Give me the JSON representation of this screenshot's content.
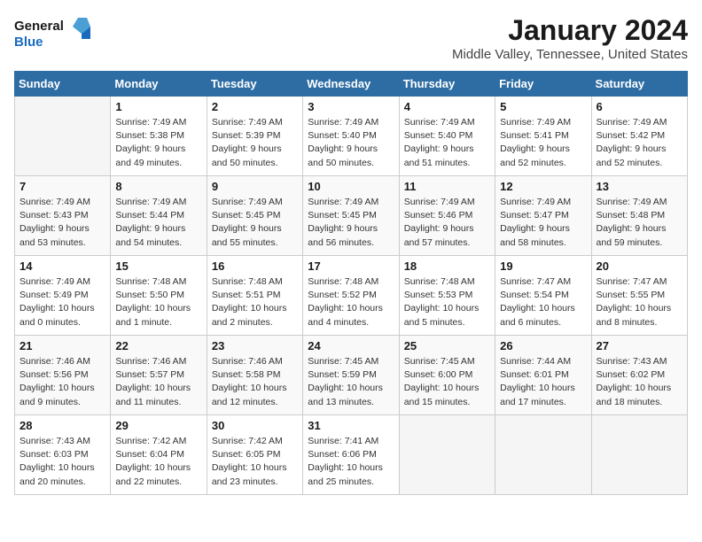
{
  "header": {
    "logo_line1": "General",
    "logo_line2": "Blue",
    "month": "January 2024",
    "location": "Middle Valley, Tennessee, United States"
  },
  "weekdays": [
    "Sunday",
    "Monday",
    "Tuesday",
    "Wednesday",
    "Thursday",
    "Friday",
    "Saturday"
  ],
  "weeks": [
    [
      {
        "day": "",
        "empty": true
      },
      {
        "day": "1",
        "sunrise": "7:49 AM",
        "sunset": "5:38 PM",
        "daylight": "9 hours and 49 minutes."
      },
      {
        "day": "2",
        "sunrise": "7:49 AM",
        "sunset": "5:39 PM",
        "daylight": "9 hours and 50 minutes."
      },
      {
        "day": "3",
        "sunrise": "7:49 AM",
        "sunset": "5:40 PM",
        "daylight": "9 hours and 50 minutes."
      },
      {
        "day": "4",
        "sunrise": "7:49 AM",
        "sunset": "5:40 PM",
        "daylight": "9 hours and 51 minutes."
      },
      {
        "day": "5",
        "sunrise": "7:49 AM",
        "sunset": "5:41 PM",
        "daylight": "9 hours and 52 minutes."
      },
      {
        "day": "6",
        "sunrise": "7:49 AM",
        "sunset": "5:42 PM",
        "daylight": "9 hours and 52 minutes."
      }
    ],
    [
      {
        "day": "7",
        "sunrise": "7:49 AM",
        "sunset": "5:43 PM",
        "daylight": "9 hours and 53 minutes."
      },
      {
        "day": "8",
        "sunrise": "7:49 AM",
        "sunset": "5:44 PM",
        "daylight": "9 hours and 54 minutes."
      },
      {
        "day": "9",
        "sunrise": "7:49 AM",
        "sunset": "5:45 PM",
        "daylight": "9 hours and 55 minutes."
      },
      {
        "day": "10",
        "sunrise": "7:49 AM",
        "sunset": "5:45 PM",
        "daylight": "9 hours and 56 minutes."
      },
      {
        "day": "11",
        "sunrise": "7:49 AM",
        "sunset": "5:46 PM",
        "daylight": "9 hours and 57 minutes."
      },
      {
        "day": "12",
        "sunrise": "7:49 AM",
        "sunset": "5:47 PM",
        "daylight": "9 hours and 58 minutes."
      },
      {
        "day": "13",
        "sunrise": "7:49 AM",
        "sunset": "5:48 PM",
        "daylight": "9 hours and 59 minutes."
      }
    ],
    [
      {
        "day": "14",
        "sunrise": "7:49 AM",
        "sunset": "5:49 PM",
        "daylight": "10 hours and 0 minutes."
      },
      {
        "day": "15",
        "sunrise": "7:48 AM",
        "sunset": "5:50 PM",
        "daylight": "10 hours and 1 minute."
      },
      {
        "day": "16",
        "sunrise": "7:48 AM",
        "sunset": "5:51 PM",
        "daylight": "10 hours and 2 minutes."
      },
      {
        "day": "17",
        "sunrise": "7:48 AM",
        "sunset": "5:52 PM",
        "daylight": "10 hours and 4 minutes."
      },
      {
        "day": "18",
        "sunrise": "7:48 AM",
        "sunset": "5:53 PM",
        "daylight": "10 hours and 5 minutes."
      },
      {
        "day": "19",
        "sunrise": "7:47 AM",
        "sunset": "5:54 PM",
        "daylight": "10 hours and 6 minutes."
      },
      {
        "day": "20",
        "sunrise": "7:47 AM",
        "sunset": "5:55 PM",
        "daylight": "10 hours and 8 minutes."
      }
    ],
    [
      {
        "day": "21",
        "sunrise": "7:46 AM",
        "sunset": "5:56 PM",
        "daylight": "10 hours and 9 minutes."
      },
      {
        "day": "22",
        "sunrise": "7:46 AM",
        "sunset": "5:57 PM",
        "daylight": "10 hours and 11 minutes."
      },
      {
        "day": "23",
        "sunrise": "7:46 AM",
        "sunset": "5:58 PM",
        "daylight": "10 hours and 12 minutes."
      },
      {
        "day": "24",
        "sunrise": "7:45 AM",
        "sunset": "5:59 PM",
        "daylight": "10 hours and 13 minutes."
      },
      {
        "day": "25",
        "sunrise": "7:45 AM",
        "sunset": "6:00 PM",
        "daylight": "10 hours and 15 minutes."
      },
      {
        "day": "26",
        "sunrise": "7:44 AM",
        "sunset": "6:01 PM",
        "daylight": "10 hours and 17 minutes."
      },
      {
        "day": "27",
        "sunrise": "7:43 AM",
        "sunset": "6:02 PM",
        "daylight": "10 hours and 18 minutes."
      }
    ],
    [
      {
        "day": "28",
        "sunrise": "7:43 AM",
        "sunset": "6:03 PM",
        "daylight": "10 hours and 20 minutes."
      },
      {
        "day": "29",
        "sunrise": "7:42 AM",
        "sunset": "6:04 PM",
        "daylight": "10 hours and 22 minutes."
      },
      {
        "day": "30",
        "sunrise": "7:42 AM",
        "sunset": "6:05 PM",
        "daylight": "10 hours and 23 minutes."
      },
      {
        "day": "31",
        "sunrise": "7:41 AM",
        "sunset": "6:06 PM",
        "daylight": "10 hours and 25 minutes."
      },
      {
        "day": "",
        "empty": true
      },
      {
        "day": "",
        "empty": true
      },
      {
        "day": "",
        "empty": true
      }
    ]
  ],
  "labels": {
    "sunrise": "Sunrise:",
    "sunset": "Sunset:",
    "daylight": "Daylight:"
  }
}
